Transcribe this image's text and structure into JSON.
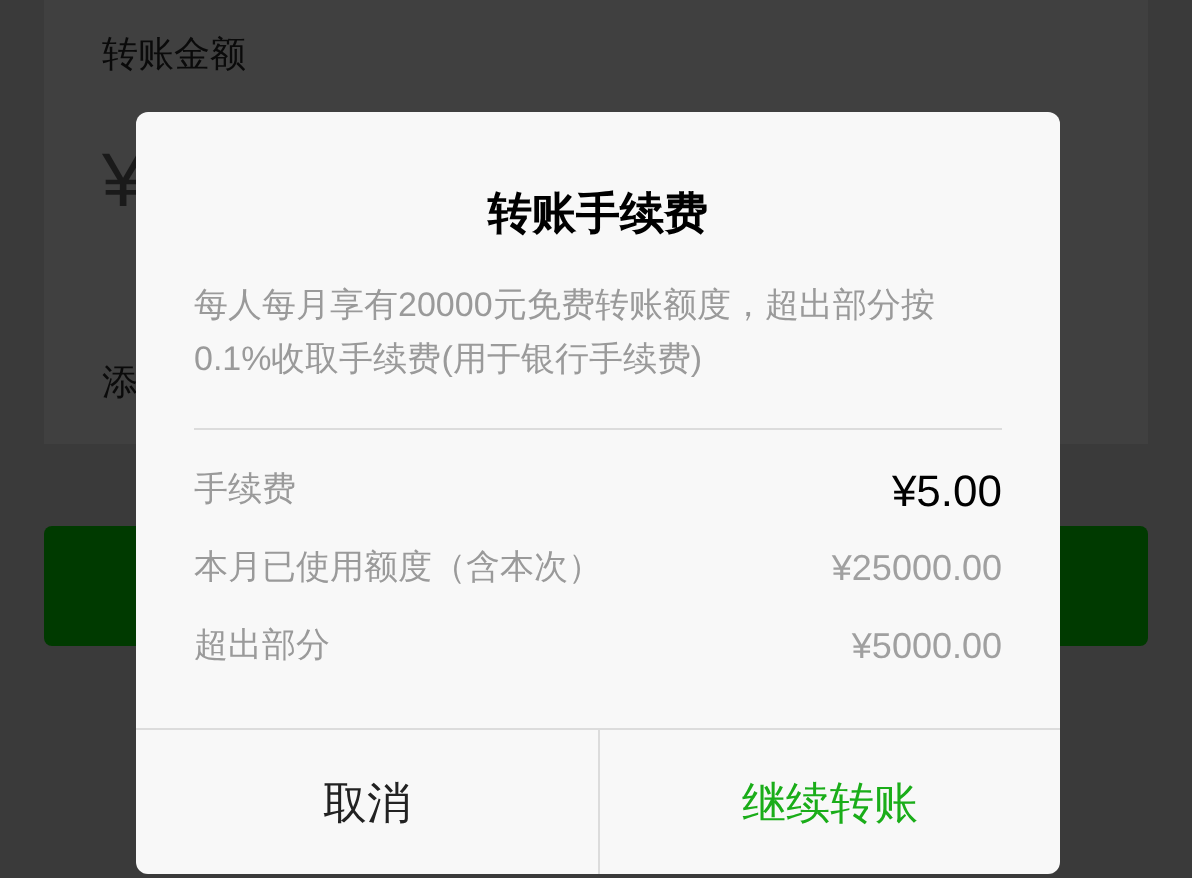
{
  "background": {
    "amount_label": "转账金额",
    "currency": "¥",
    "note_label": "添"
  },
  "dialog": {
    "title": "转账手续费",
    "description": "每人每月享有20000元免费转账额度，超出部分按0.1%收取手续费(用于银行手续费)",
    "rows": [
      {
        "label": "手续费",
        "value": "¥5.00",
        "kind": "primary"
      },
      {
        "label": "本月已使用额度（含本次）",
        "value": "¥25000.00",
        "kind": "secondary"
      },
      {
        "label": "超出部分",
        "value": "¥5000.00",
        "kind": "secondary"
      }
    ],
    "buttons": [
      {
        "label": "取消",
        "kind": "cancel"
      },
      {
        "label": "继续转账",
        "kind": "confirm"
      }
    ]
  }
}
